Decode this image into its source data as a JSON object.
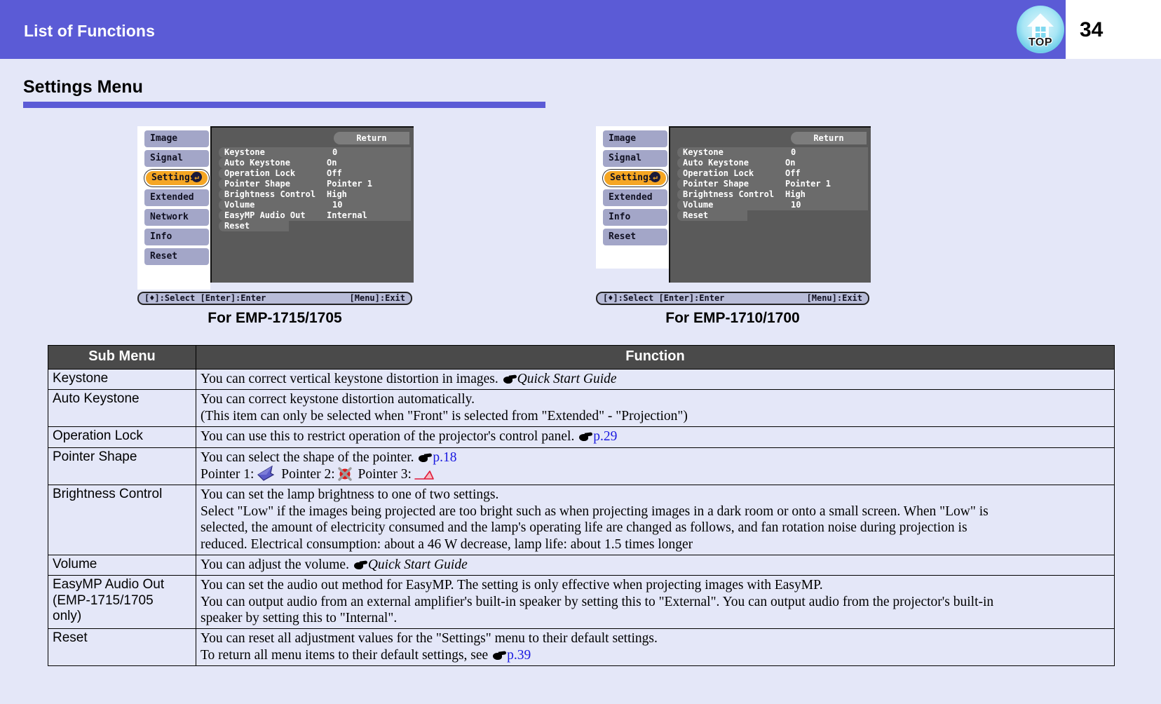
{
  "header": {
    "title": "List of Functions",
    "page_number": "34",
    "top_icon_label": "TOP"
  },
  "page": {
    "heading": "Settings Menu"
  },
  "osd_menus": [
    {
      "id": "left",
      "caption": "For EMP-1715/1705",
      "return_label": "Return",
      "sidebar": [
        {
          "label": "Image",
          "selected": false
        },
        {
          "label": "Signal",
          "selected": false
        },
        {
          "label": "Settings",
          "selected": true
        },
        {
          "label": "Extended",
          "selected": false
        },
        {
          "label": "Network",
          "selected": false
        },
        {
          "label": "Info",
          "selected": false
        },
        {
          "label": "Reset",
          "selected": false
        }
      ],
      "rows": [
        {
          "label": "Keystone",
          "value": "0",
          "numeric": true
        },
        {
          "label": "Auto Keystone",
          "value": "On",
          "numeric": false
        },
        {
          "label": "Operation Lock",
          "value": "Off",
          "numeric": false
        },
        {
          "label": "Pointer Shape",
          "value": "Pointer 1",
          "numeric": false
        },
        {
          "label": "Brightness Control",
          "value": "High",
          "numeric": false
        },
        {
          "label": "Volume",
          "value": "10",
          "numeric": true
        },
        {
          "label": "EasyMP Audio Out",
          "value": "Internal",
          "numeric": false
        },
        {
          "label": "Reset",
          "value": "",
          "numeric": false
        }
      ],
      "footer_left": "[♦]:Select [Enter]:Enter",
      "footer_right": "[Menu]:Exit"
    },
    {
      "id": "right",
      "caption": "For EMP-1710/1700",
      "return_label": "Return",
      "sidebar": [
        {
          "label": "Image",
          "selected": false
        },
        {
          "label": "Signal",
          "selected": false
        },
        {
          "label": "Settings",
          "selected": true
        },
        {
          "label": "Extended",
          "selected": false
        },
        {
          "label": "Info",
          "selected": false
        },
        {
          "label": "Reset",
          "selected": false
        }
      ],
      "rows": [
        {
          "label": "Keystone",
          "value": "0",
          "numeric": true
        },
        {
          "label": "Auto Keystone",
          "value": "On",
          "numeric": false
        },
        {
          "label": "Operation Lock",
          "value": "Off",
          "numeric": false
        },
        {
          "label": "Pointer Shape",
          "value": "Pointer 1",
          "numeric": false
        },
        {
          "label": "Brightness Control",
          "value": "High",
          "numeric": false
        },
        {
          "label": "Volume",
          "value": "10",
          "numeric": true
        },
        {
          "label": "Reset",
          "value": "",
          "numeric": false
        }
      ],
      "footer_left": "[♦]:Select [Enter]:Enter",
      "footer_right": "[Menu]:Exit"
    }
  ],
  "table": {
    "headers": {
      "sub_menu": "Sub Menu",
      "function": "Function"
    },
    "rows": [
      {
        "sub_menu": "Keystone",
        "lines": [
          {
            "text": "You can correct vertical keystone distortion in images. ",
            "hand": true,
            "ref": "Quick Start Guide",
            "ref_style": "italic"
          }
        ]
      },
      {
        "sub_menu": "Auto Keystone",
        "lines": [
          {
            "text": "You can correct keystone distortion automatically."
          },
          {
            "text": "(This item can only be selected when \"Front\" is selected from \"Extended\" - \"Projection\")"
          }
        ]
      },
      {
        "sub_menu": "Operation Lock",
        "lines": [
          {
            "text": "You can use this to restrict operation of the projector's control panel. ",
            "hand": true,
            "ref": "p.29",
            "ref_style": "link"
          }
        ]
      },
      {
        "sub_menu": "Pointer Shape",
        "lines": [
          {
            "text": "You can select the shape of the pointer. ",
            "hand": true,
            "ref": "p.18",
            "ref_style": "link"
          },
          {
            "pointers": true,
            "p1": "Pointer 1:",
            "p2": "Pointer 2:",
            "p3": "Pointer 3:"
          }
        ]
      },
      {
        "sub_menu": "Brightness Control",
        "lines": [
          {
            "text": "You can set the lamp brightness to one of two settings."
          },
          {
            "text": "Select \"Low\" if the images being projected are too bright such as when projecting images in a dark room or onto a small screen. When \"Low\" is"
          },
          {
            "text": "selected, the amount of electricity consumed and the lamp's operating life are changed as follows, and fan rotation noise during projection is"
          },
          {
            "text": "reduced. Electrical consumption: about a 46 W decrease, lamp life: about 1.5 times longer"
          }
        ]
      },
      {
        "sub_menu": "Volume",
        "lines": [
          {
            "text": "You can adjust the volume. ",
            "hand": true,
            "ref": "Quick Start Guide",
            "ref_style": "italic"
          }
        ]
      },
      {
        "sub_menu": "EasyMP Audio Out\n(EMP-1715/1705\nonly)",
        "lines": [
          {
            "text": "You can set the audio out method for EasyMP.  The setting is only effective when projecting images with EasyMP."
          },
          {
            "text": "You can output audio from an external amplifier's built-in speaker by setting this to \"External\". You can output audio from the projector's built-in"
          },
          {
            "text": "speaker by setting this to \"Internal\"."
          }
        ]
      },
      {
        "sub_menu": "Reset",
        "lines": [
          {
            "text": "You can reset all adjustment values for the \"Settings\" menu to their default settings."
          },
          {
            "text": "To return all menu items to their default settings, see ",
            "hand": true,
            "ref": "p.39",
            "ref_style": "link"
          }
        ]
      }
    ]
  },
  "colors": {
    "header_band": "#5b5bd6",
    "page_background": "#e4e7f8",
    "accent_rule": "#5b5bd6",
    "osd_selected": "#f5a623",
    "osd_tab": "#a3a6c8",
    "osd_panel": "#5a5a5a",
    "table_header": "#4a4a4a",
    "link": "#1a1ae0"
  }
}
